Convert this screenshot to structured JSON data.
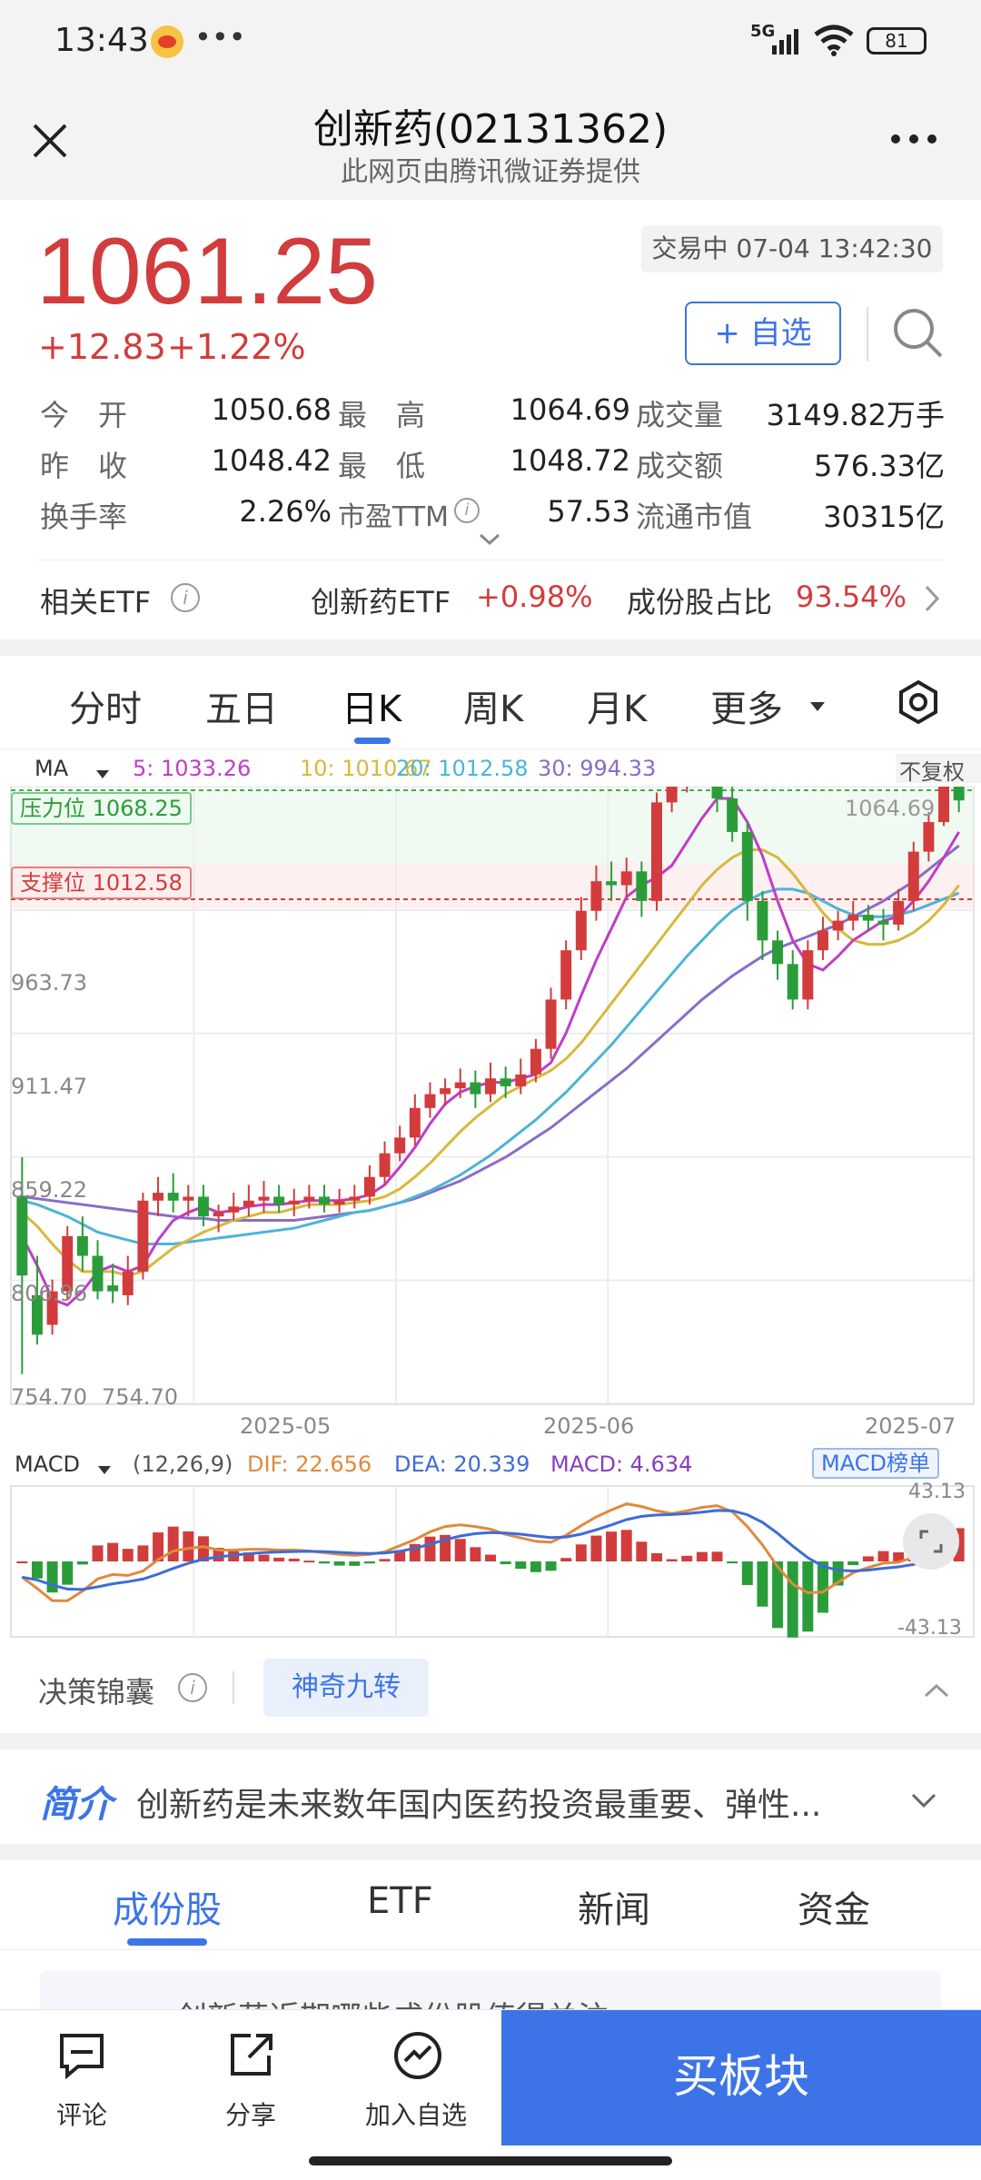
{
  "status": {
    "time": "13:43",
    "dots": "•••",
    "network": "5G",
    "battery": "81"
  },
  "header": {
    "title": "创新药(02131362)",
    "subtitle": "此网页由腾讯微证券提供"
  },
  "quote": {
    "price": "1061.25",
    "change": "+12.83",
    "change_pct": "+1.22%",
    "status_time": "交易中 07-04 13:42:30",
    "watch_label": "+ 自选",
    "stats": [
      {
        "label": "今　开",
        "value": "1050.68",
        "color": "red"
      },
      {
        "label": "最　高",
        "value": "1064.69",
        "color": "red"
      },
      {
        "label": "成交量",
        "value": "3149.82万手",
        "color": "dark"
      },
      {
        "label": "昨　收",
        "value": "1048.42",
        "color": "dark"
      },
      {
        "label": "最　低",
        "value": "1048.72",
        "color": "red"
      },
      {
        "label": "成交额",
        "value": "576.33亿",
        "color": "dark"
      },
      {
        "label": "换手率",
        "value": "2.26%",
        "color": "dark"
      },
      {
        "label": "市盈TTM",
        "value": "57.53",
        "color": "dark"
      },
      {
        "label": "流通市值",
        "value": "30315亿",
        "color": "dark"
      }
    ]
  },
  "etf": {
    "label": "相关ETF",
    "name": "创新药ETF",
    "change": "+0.98%",
    "ratio_label": "成份股占比",
    "ratio": "93.54%"
  },
  "chart_tabs": {
    "items": [
      "分时",
      "五日",
      "日K",
      "周K",
      "月K",
      "更多"
    ],
    "active": 2
  },
  "ma_legend": {
    "label": "MA",
    "ma5": "5: 1033.26",
    "ma10": "10: 1010.67",
    "ma20": "20: 1012.58",
    "ma30": "30: 994.33",
    "adj": "不复权"
  },
  "levels": {
    "resistance": "压力位 1068.25",
    "support": "支撑位 1012.58"
  },
  "macd_legend": {
    "label": "MACD",
    "params": "(12,26,9)",
    "dif": "DIF: 22.656",
    "dea": "DEA: 20.339",
    "macd": "MACD: 4.634",
    "rank": "MACD榜单"
  },
  "colors": {
    "up": "#d23c3c",
    "down": "#2a9d3a",
    "ma5": "#c03cc8",
    "ma10": "#d8b83c",
    "ma20": "#4cb4d8",
    "ma30": "#8a6cc8",
    "dif": "#e08a3c",
    "dea": "#3c6cd8",
    "accent": "#3c74e8"
  },
  "chart_data": {
    "type": "candlestick",
    "y_ticks": [
      "963.73",
      "911.47",
      "859.22",
      "806.96",
      "754.70"
    ],
    "y_min_label": "754.70",
    "high_label": "1064.69",
    "x_ticks": [
      "2025-05",
      "2025-06",
      "2025-07"
    ],
    "ylim": [
      754.7,
      1068.0
    ],
    "candles": [
      [
        860,
        820,
        880,
        770
      ],
      [
        810,
        790,
        830,
        785
      ],
      [
        795,
        812,
        818,
        790
      ],
      [
        812,
        840,
        845,
        808
      ],
      [
        840,
        830,
        850,
        822
      ],
      [
        830,
        812,
        838,
        808
      ],
      [
        815,
        812,
        826,
        806
      ],
      [
        810,
        822,
        830,
        805
      ],
      [
        822,
        858,
        862,
        818
      ],
      [
        858,
        862,
        870,
        850
      ],
      [
        862,
        858,
        872,
        852
      ],
      [
        858,
        860,
        866,
        850
      ],
      [
        860,
        850,
        866,
        845
      ],
      [
        850,
        852,
        856,
        842
      ],
      [
        852,
        855,
        862,
        848
      ],
      [
        855,
        858,
        866,
        850
      ],
      [
        858,
        860,
        868,
        852
      ],
      [
        860,
        856,
        866,
        852
      ],
      [
        856,
        858,
        864,
        850
      ],
      [
        858,
        860,
        866,
        854
      ],
      [
        860,
        856,
        866,
        852
      ],
      [
        856,
        858,
        864,
        852
      ],
      [
        858,
        860,
        866,
        854
      ],
      [
        860,
        870,
        876,
        856
      ],
      [
        870,
        882,
        888,
        866
      ],
      [
        882,
        890,
        896,
        878
      ],
      [
        890,
        905,
        912,
        886
      ],
      [
        905,
        912,
        918,
        900
      ],
      [
        912,
        915,
        920,
        906
      ],
      [
        915,
        918,
        925,
        910
      ],
      [
        918,
        912,
        924,
        905
      ],
      [
        912,
        920,
        928,
        908
      ],
      [
        920,
        916,
        926,
        910
      ],
      [
        916,
        922,
        930,
        912
      ],
      [
        922,
        935,
        940,
        918
      ],
      [
        935,
        960,
        966,
        930
      ],
      [
        960,
        985,
        990,
        955
      ],
      [
        985,
        1005,
        1012,
        980
      ],
      [
        1005,
        1020,
        1028,
        1000
      ],
      [
        1020,
        1018,
        1030,
        1010
      ],
      [
        1018,
        1025,
        1032,
        1012
      ],
      [
        1025,
        1010,
        1030,
        1002
      ],
      [
        1010,
        1060,
        1065,
        1005
      ],
      [
        1060,
        1070,
        1078,
        1055
      ],
      [
        1070,
        1080,
        1088,
        1065
      ],
      [
        1080,
        1072,
        1090,
        1068
      ],
      [
        1072,
        1062,
        1078,
        1055
      ],
      [
        1062,
        1045,
        1070,
        1040
      ],
      [
        1045,
        1010,
        1050,
        1000
      ],
      [
        1010,
        990,
        1015,
        980
      ],
      [
        990,
        978,
        995,
        970
      ],
      [
        978,
        960,
        985,
        955
      ],
      [
        960,
        985,
        990,
        955
      ],
      [
        985,
        995,
        1002,
        980
      ],
      [
        995,
        1000,
        1005,
        990
      ],
      [
        1000,
        1003,
        1010,
        995
      ],
      [
        1003,
        1000,
        1008,
        995
      ],
      [
        1000,
        998,
        1006,
        990
      ],
      [
        998,
        1010,
        1016,
        995
      ],
      [
        1010,
        1035,
        1040,
        1005
      ],
      [
        1035,
        1050,
        1055,
        1030
      ],
      [
        1050,
        1068,
        1070,
        1048
      ],
      [
        1068,
        1061,
        1072,
        1055
      ]
    ],
    "ma5": [
      840,
      825,
      808,
      805,
      812,
      822,
      825,
      822,
      825,
      838,
      848,
      852,
      855,
      852,
      853,
      855,
      856,
      856,
      857,
      858,
      858,
      858,
      859,
      861,
      866,
      875,
      885,
      897,
      907,
      913,
      916,
      918,
      918,
      920,
      922,
      928,
      943,
      962,
      980,
      996,
      1012,
      1018,
      1022,
      1028,
      1040,
      1052,
      1062,
      1062,
      1050,
      1033,
      1010,
      990,
      978,
      975,
      982,
      990,
      995,
      1000,
      1002,
      1010,
      1020,
      1032,
      1045
    ],
    "ma10": [
      852,
      845,
      836,
      828,
      822,
      822,
      822,
      820,
      822,
      828,
      834,
      838,
      842,
      845,
      848,
      850,
      852,
      852,
      854,
      856,
      856,
      856,
      857,
      858,
      860,
      864,
      870,
      877,
      885,
      893,
      900,
      906,
      912,
      916,
      920,
      924,
      930,
      938,
      948,
      958,
      968,
      978,
      988,
      998,
      1008,
      1018,
      1026,
      1032,
      1036,
      1036,
      1032,
      1024,
      1014,
      1004,
      996,
      990,
      988,
      988,
      990,
      994,
      1000,
      1008,
      1018
    ],
    "ma20": [
      858,
      856,
      853,
      850,
      846,
      842,
      840,
      838,
      836,
      836,
      836,
      837,
      838,
      839,
      840,
      841,
      842,
      843,
      844,
      846,
      848,
      850,
      852,
      853,
      855,
      857,
      860,
      863,
      867,
      871,
      876,
      881,
      887,
      893,
      899,
      906,
      913,
      921,
      929,
      937,
      946,
      955,
      964,
      973,
      982,
      990,
      998,
      1005,
      1010,
      1014,
      1016,
      1016,
      1014,
      1010,
      1006,
      1003,
      1002,
      1002,
      1003,
      1005,
      1008,
      1011,
      1014
    ],
    "ma30": [
      860,
      859,
      858,
      857,
      856,
      855,
      854,
      853,
      852,
      851,
      850,
      849,
      849,
      848,
      848,
      848,
      848,
      848,
      848,
      849,
      850,
      851,
      852,
      853,
      855,
      857,
      859,
      862,
      865,
      868,
      872,
      876,
      880,
      885,
      890,
      895,
      901,
      907,
      913,
      919,
      925,
      932,
      939,
      946,
      953,
      960,
      966,
      972,
      977,
      982,
      986,
      989,
      992,
      995,
      998,
      1002,
      1006,
      1010,
      1015,
      1020,
      1026,
      1032,
      1038
    ],
    "macd_ylim": [
      "43.13",
      "-43.13"
    ]
  },
  "decision": {
    "label": "决策锦囊",
    "tag": "神奇九转"
  },
  "intro": {
    "label": "简介",
    "text": "创新药是未来数年国内医药投资最重要、弹性..."
  },
  "sections": {
    "items": [
      "成份股",
      "ETF",
      "新闻",
      "资金"
    ],
    "active": 0
  },
  "partial_row": "创新药近期哪些成份股值得关注",
  "bottom": {
    "comment": "评论",
    "share": "分享",
    "add_watch": "加入自选",
    "buy": "买板块"
  }
}
